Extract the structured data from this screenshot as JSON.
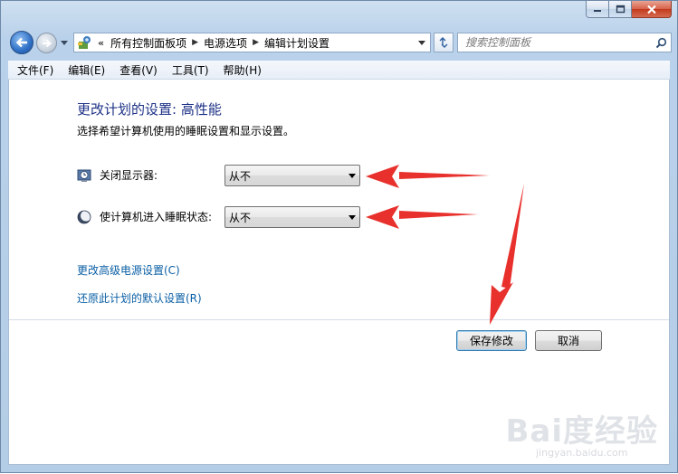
{
  "window": {
    "caption": {
      "minimize_icon": "minimize-icon",
      "maximize_icon": "maximize-icon",
      "close_icon": "close-icon"
    }
  },
  "navigation": {
    "breadcrumb_prefix": "«",
    "breadcrumbs": [
      "所有控制面板项",
      "电源选项",
      "编辑计划设置"
    ],
    "search_placeholder": "搜索控制面板"
  },
  "menu": {
    "items": [
      "文件(F)",
      "编辑(E)",
      "查看(V)",
      "工具(T)",
      "帮助(H)"
    ]
  },
  "main": {
    "title": "更改计划的设置: 高性能",
    "subtitle": "选择希望计算机使用的睡眠设置和显示设置。",
    "settings": [
      {
        "label": "关闭显示器:",
        "value": "从不",
        "icon": "display-timer-icon"
      },
      {
        "label": "使计算机进入睡眠状态:",
        "value": "从不",
        "icon": "sleep-moon-icon"
      }
    ],
    "links": [
      "更改高级电源设置(C)",
      "还原此计划的默认设置(R)"
    ],
    "buttons": {
      "save": "保存修改",
      "cancel": "取消"
    }
  },
  "watermark": {
    "main": "Bai度经验",
    "sub": "jingyan.baidu.com"
  },
  "colors": {
    "title": "#1e3287",
    "link": "#0b5fa5",
    "annotation": "#e8302c"
  }
}
